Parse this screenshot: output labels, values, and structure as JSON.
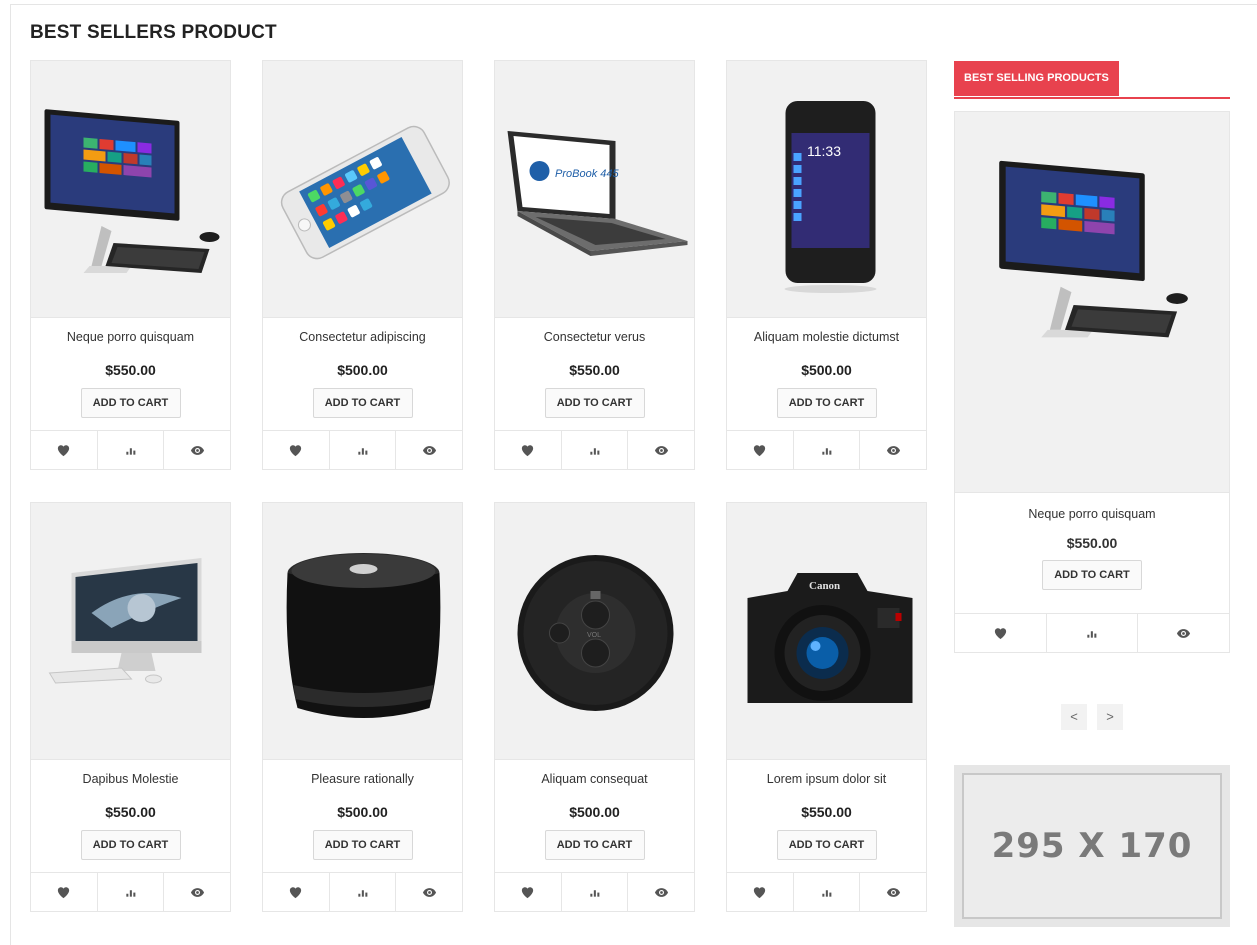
{
  "section": {
    "title": "BEST SELLERS PRODUCT"
  },
  "products": [
    {
      "name": "Neque porro quisquam",
      "price": "$550.00",
      "cart_label": "ADD TO CART",
      "image": "all-in-one-pc"
    },
    {
      "name": "Consectetur adipiscing",
      "price": "$500.00",
      "cart_label": "ADD TO CART",
      "image": "iphone"
    },
    {
      "name": "Consectetur verus",
      "price": "$550.00",
      "cart_label": "ADD TO CART",
      "image": "hp-laptop",
      "image_text": "ProBook 445"
    },
    {
      "name": "Aliquam molestie dictumst",
      "price": "$500.00",
      "cart_label": "ADD TO CART",
      "image": "blackberry-phone",
      "image_text": "11:33"
    },
    {
      "name": "Dapibus Molestie",
      "price": "$550.00",
      "cart_label": "ADD TO CART",
      "image": "imac"
    },
    {
      "name": "Pleasure rationally",
      "price": "$500.00",
      "cart_label": "ADD TO CART",
      "image": "speaker"
    },
    {
      "name": "Aliquam consequat",
      "price": "$500.00",
      "cart_label": "ADD TO CART",
      "image": "round-speaker",
      "image_text": "VOL"
    },
    {
      "name": "Lorem ipsum dolor sit",
      "price": "$550.00",
      "cart_label": "ADD TO CART",
      "image": "canon-camera",
      "image_text": "Canon"
    }
  ],
  "icons": {
    "wishlist": "heart-icon",
    "compare": "bar-chart-icon",
    "quick_view": "eye-icon"
  },
  "sidebar": {
    "tab_label": "BEST SELLING PRODUCTS",
    "product": {
      "name": "Neque porro quisquam",
      "price": "$550.00",
      "cart_label": "ADD TO CART",
      "image": "all-in-one-pc"
    },
    "prev_label": "<",
    "next_label": ">"
  },
  "banner": {
    "text": "295 X 170"
  },
  "colors": {
    "accent": "#e8424e",
    "icon": "#555555",
    "image_bg": "#f1f1f1"
  }
}
